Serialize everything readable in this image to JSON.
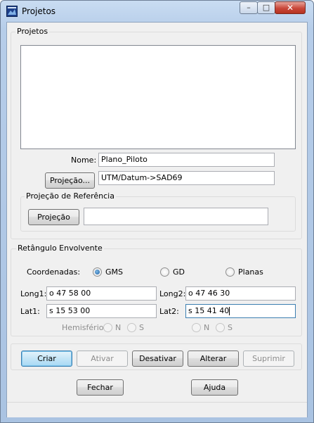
{
  "window": {
    "title": "Projetos"
  },
  "projects": {
    "group_label": "Projetos",
    "nome_label": "Nome:",
    "nome_value": "Plano_Piloto",
    "projecao_button": "Projeção...",
    "projecao_value": "UTM/Datum->SAD69",
    "ref_group_label": "Projeção de Referência",
    "ref_button": "Projeção",
    "ref_value": ""
  },
  "bbox": {
    "group_label": "Retângulo Envolvente",
    "coord_label": "Coordenadas:",
    "options": [
      {
        "label": "GMS",
        "selected": true
      },
      {
        "label": "GD",
        "selected": false
      },
      {
        "label": "Planas",
        "selected": false
      }
    ],
    "long1_label": "Long1:",
    "long1_value": "o 47 58 00",
    "long2_label": "Long2:",
    "long2_value": "o 47 46 30",
    "lat1_label": "Lat1:",
    "lat1_value": "s 15 53 00",
    "lat2_label": "Lat2:",
    "lat2_value": "s 15 41 40",
    "hemisferio_label": "Hemisfério:",
    "n_label": "N",
    "s_label": "S"
  },
  "actions": {
    "criar": "Criar",
    "ativar": "Ativar",
    "desativar": "Desativar",
    "alterar": "Alterar",
    "suprimir": "Suprimir",
    "fechar": "Fechar",
    "ajuda": "Ajuda"
  },
  "icons": {
    "app": "map-app-icon",
    "minimize": "minimize-icon",
    "maximize": "maximize-icon",
    "close": "close-icon"
  }
}
